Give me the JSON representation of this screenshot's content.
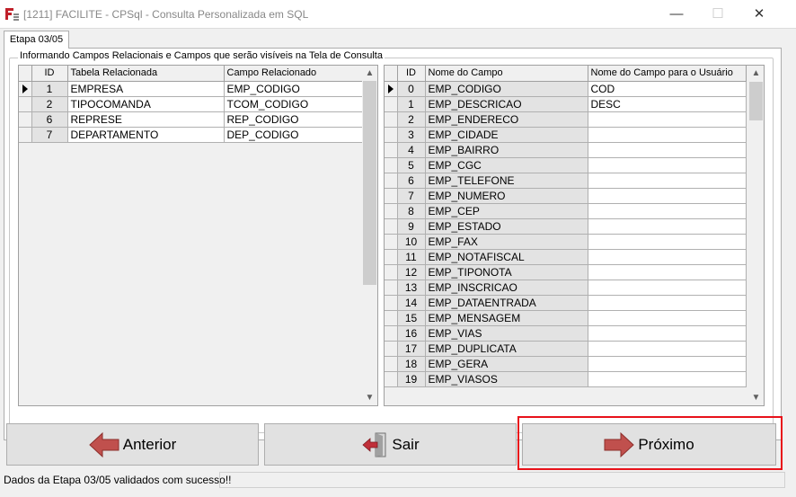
{
  "window": {
    "title": "[1211] FACILITE - CPSql - Consulta Personalizada em SQL",
    "minimize_glyph": "—",
    "maximize_glyph": "☐",
    "close_glyph": "✕"
  },
  "tab": {
    "label": "Etapa 03/05"
  },
  "group": {
    "title": "Informando Campos Relacionais e Campos que serão visíveis na Tela de Consulta"
  },
  "left_grid": {
    "headers": {
      "id": "ID",
      "table": "Tabela Relacionada",
      "field": "Campo Relacionado"
    },
    "rows": [
      {
        "id": "1",
        "table": "EMPRESA",
        "field": "EMP_CODIGO"
      },
      {
        "id": "2",
        "table": "TIPOCOMANDA",
        "field": "TCOM_CODIGO"
      },
      {
        "id": "6",
        "table": "REPRESE",
        "field": "REP_CODIGO"
      },
      {
        "id": "7",
        "table": "DEPARTAMENTO",
        "field": "DEP_CODIGO"
      }
    ]
  },
  "right_grid": {
    "headers": {
      "id": "ID",
      "name": "Nome do Campo",
      "user_name": "Nome do Campo para o Usuário"
    },
    "rows": [
      {
        "id": "0",
        "name": "EMP_CODIGO",
        "user_name": "COD"
      },
      {
        "id": "1",
        "name": "EMP_DESCRICAO",
        "user_name": "DESC"
      },
      {
        "id": "2",
        "name": "EMP_ENDERECO",
        "user_name": ""
      },
      {
        "id": "3",
        "name": "EMP_CIDADE",
        "user_name": ""
      },
      {
        "id": "4",
        "name": "EMP_BAIRRO",
        "user_name": ""
      },
      {
        "id": "5",
        "name": "EMP_CGC",
        "user_name": ""
      },
      {
        "id": "6",
        "name": "EMP_TELEFONE",
        "user_name": ""
      },
      {
        "id": "7",
        "name": "EMP_NUMERO",
        "user_name": ""
      },
      {
        "id": "8",
        "name": "EMP_CEP",
        "user_name": ""
      },
      {
        "id": "9",
        "name": "EMP_ESTADO",
        "user_name": ""
      },
      {
        "id": "10",
        "name": "EMP_FAX",
        "user_name": ""
      },
      {
        "id": "11",
        "name": "EMP_NOTAFISCAL",
        "user_name": ""
      },
      {
        "id": "12",
        "name": "EMP_TIPONOTA",
        "user_name": ""
      },
      {
        "id": "13",
        "name": "EMP_INSCRICAO",
        "user_name": ""
      },
      {
        "id": "14",
        "name": "EMP_DATAENTRADA",
        "user_name": ""
      },
      {
        "id": "15",
        "name": "EMP_MENSAGEM",
        "user_name": ""
      },
      {
        "id": "16",
        "name": "EMP_VIAS",
        "user_name": ""
      },
      {
        "id": "17",
        "name": "EMP_DUPLICATA",
        "user_name": ""
      },
      {
        "id": "18",
        "name": "EMP_GERA",
        "user_name": ""
      },
      {
        "id": "19",
        "name": "EMP_VIASOS",
        "user_name": ""
      }
    ]
  },
  "buttons": {
    "previous": "Anterior",
    "exit": "Sair",
    "next": "Próximo"
  },
  "status": {
    "message": "Dados da Etapa 03/05 validados com sucesso!!"
  },
  "colors": {
    "arrow_red": "#c0504d",
    "highlight_border": "#e8121a",
    "app_icon_red": "#c0202a",
    "door_red": "#c0303a"
  }
}
